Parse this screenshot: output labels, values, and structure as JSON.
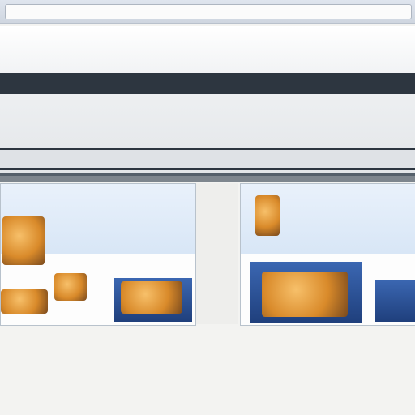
{
  "browser": {
    "address_text": ""
  },
  "banner": {
    "nav_items": [
      "",
      "",
      "",
      "",
      "",
      "",
      ""
    ],
    "promo_items": [
      "",
      "",
      "",
      ""
    ],
    "headline": "",
    "subline": ""
  },
  "cards": {
    "left": {
      "title": "",
      "lines": [
        "",
        "",
        ""
      ]
    },
    "right": {
      "title": "",
      "lines": [
        "",
        "",
        ""
      ]
    }
  },
  "caption": "",
  "body_lines": [
    "",
    "",
    ""
  ],
  "colors": {
    "promo_strip": "#2d3640",
    "card_title": "#c3462a",
    "card_link": "#2b5c9e",
    "thumb_orange": "#d98a2a",
    "thumb_blue": "#1f3f7c"
  }
}
